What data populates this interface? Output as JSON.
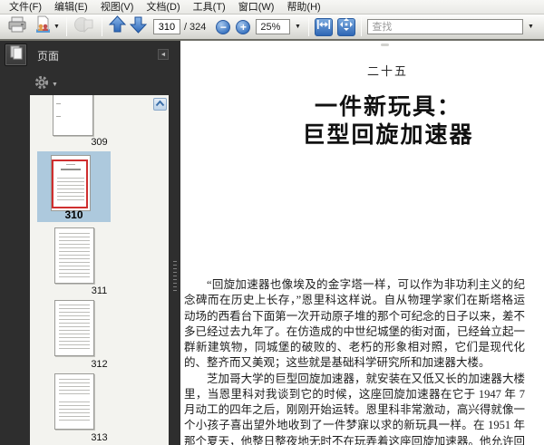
{
  "menu": {
    "items": [
      "文件(F)",
      "编辑(E)",
      "视图(V)",
      "文档(D)",
      "工具(T)",
      "窗口(W)",
      "帮助(H)"
    ]
  },
  "toolbar": {
    "page_current": "310",
    "page_total_label": "/ 324",
    "zoom_level": "25%",
    "search_placeholder": "查找"
  },
  "sidebar": {
    "panel_title": "页面",
    "thumbnails": [
      {
        "page": "309",
        "selected": false
      },
      {
        "page": "310",
        "selected": true
      },
      {
        "page": "311",
        "selected": false
      },
      {
        "page": "312",
        "selected": false
      },
      {
        "page": "313",
        "selected": false
      }
    ]
  },
  "document": {
    "chapter_number": "二十五",
    "title_line1": "一件新玩具：",
    "title_line2": "巨型回旋加速器",
    "p1_lines": [
      "“回旋加速器也像埃及的金字塔一样，可以作为非功利主义的纪",
      "念碑而在历史上长存，”恩里科这样说。自从物理学家们在斯塔格运",
      "动场的西看台下面第一次开动原子堆的那个可纪念的日子以来，差不",
      "多已经过去九年了。在仿造成的中世纪城堡的街对面，已经耸立起一",
      "群新建筑物，同城堡的破败的、老朽的形象相对照，它们是现代化",
      "的、整齐而又美观；这些就是基础科学研究所和加速器大楼。"
    ],
    "p2_lines": [
      "芝加哥大学的巨型回旋加速器，就安装在又低又长的加速器大楼",
      "里，当恩里科对我谈到它的时候，这座回旋加速器在它于 1947 年 7",
      "月动工的四年之后，刚刚开始运转。恩里科非常激动，高兴得就像一",
      "个小孩子喜出望外地收到了一件梦寐以求的新玩具一样。在 1951 年",
      "那个夏天，他整日整夜地无时不在玩弄着这座回旋加速器。他允许回"
    ]
  },
  "colors": {
    "selection_blue": "#adc9dd",
    "visible_area_red": "#cf2f2f",
    "toolbar_blue": "#3f7fce"
  }
}
